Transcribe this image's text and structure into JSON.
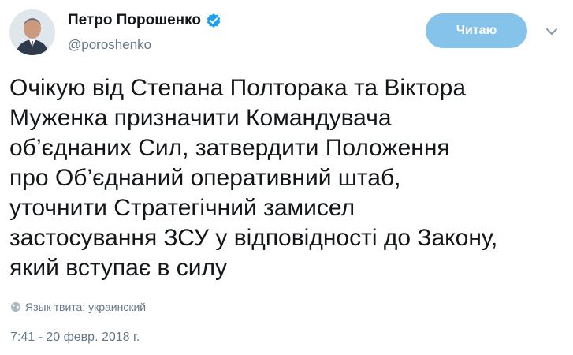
{
  "author": {
    "display_name": "Петро Порошенко",
    "handle": "@poroshenko",
    "verified": true
  },
  "follow_button": {
    "label": "Читаю"
  },
  "tweet": {
    "text_lines": [
      "Очікую від Степана Полторака та Віктора",
      "Муженка призначити Командувача",
      "об’єднаних Сил, затвердити Положення",
      "про Об’єднаний оперативний штаб,",
      "уточнити Стратегічний замисел",
      "застосування ЗСУ у відповідності до Закону,",
      "який вступає в силу"
    ],
    "language_label": "Язык твита: украинский",
    "timestamp": "7:41 - 20 февр. 2018 г."
  },
  "colors": {
    "button_bg": "#85c3eb",
    "verified_blue": "#1da1f2",
    "secondary_text": "#657786",
    "primary_text": "#14171a"
  },
  "icons": {
    "verified": "verified-badge-icon",
    "caret": "chevron-down-icon",
    "language": "globe-icon"
  }
}
